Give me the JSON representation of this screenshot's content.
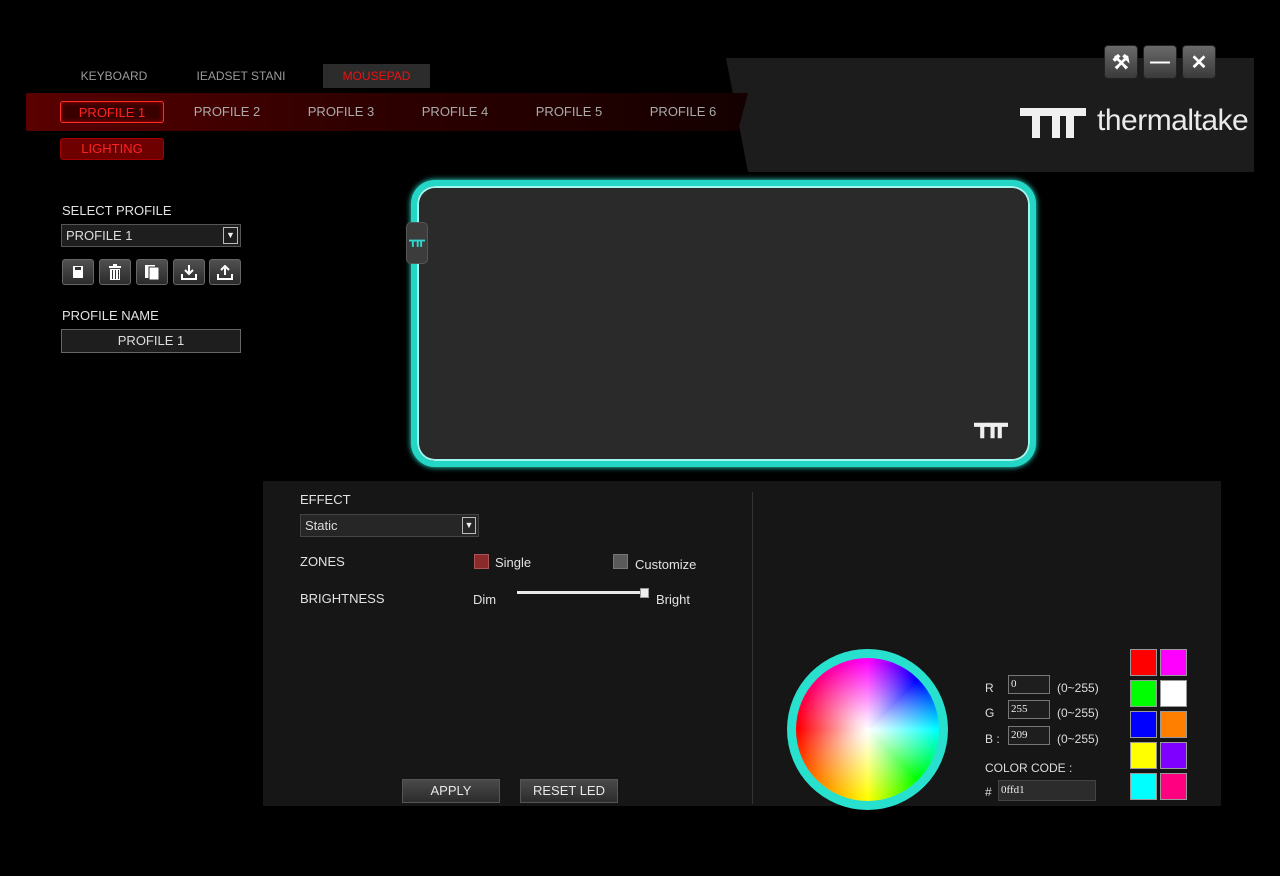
{
  "device_tabs": [
    {
      "label": "KEYBOARD",
      "active": false
    },
    {
      "label": "IEADSET STANI",
      "active": false
    },
    {
      "label": "MOUSEPAD",
      "active": true
    }
  ],
  "profile_tabs": [
    {
      "label": "PROFILE 1",
      "active": true
    },
    {
      "label": "PROFILE 2",
      "active": false
    },
    {
      "label": "PROFILE 3",
      "active": false
    },
    {
      "label": "PROFILE 4",
      "active": false
    },
    {
      "label": "PROFILE 5",
      "active": false
    },
    {
      "label": "PROFILE 6",
      "active": false
    }
  ],
  "lighting_label": "LIGHTING",
  "window_controls": {
    "settings_icon": "tools-icon",
    "minimize_icon": "minimize-icon",
    "close_icon": "close-icon"
  },
  "brand": {
    "name": "thermaltake"
  },
  "left_panel": {
    "select_profile_label": "SELECT PROFILE",
    "selected_profile": "PROFILE 1",
    "tool_icons": [
      "save-icon",
      "trash-icon",
      "copy-icon",
      "import-icon",
      "export-icon"
    ],
    "profile_name_label": "PROFILE NAME",
    "profile_name_value": "PROFILE 1"
  },
  "effect_panel": {
    "effect_label": "EFFECT",
    "effect_value": "Static",
    "zones_label": "ZONES",
    "zone_single": "Single",
    "zone_customize": "Customize",
    "brightness_label": "BRIGHTNESS",
    "brightness_dim": "Dim",
    "brightness_bright": "Bright",
    "brightness_level": 1.0,
    "apply_label": "APPLY",
    "reset_label": "RESET LED"
  },
  "color_panel": {
    "r_label": "R",
    "g_label": "G",
    "b_label": "B :",
    "r_value": "0",
    "g_value": "255",
    "b_value": "209",
    "range": "(0~255)",
    "color_code_label": "COLOR CODE :",
    "hash": "#",
    "color_code_value": "0ffd1"
  },
  "swatches": [
    "#ff0000",
    "#ff00ff",
    "#00ff00",
    "#ffffff",
    "#0000ff",
    "#ff7f00",
    "#ffff00",
    "#8000ff",
    "#00ffff",
    "#ff0080"
  ],
  "colors": {
    "accent_red": "#ff2222",
    "glow": "#24d6c6"
  }
}
